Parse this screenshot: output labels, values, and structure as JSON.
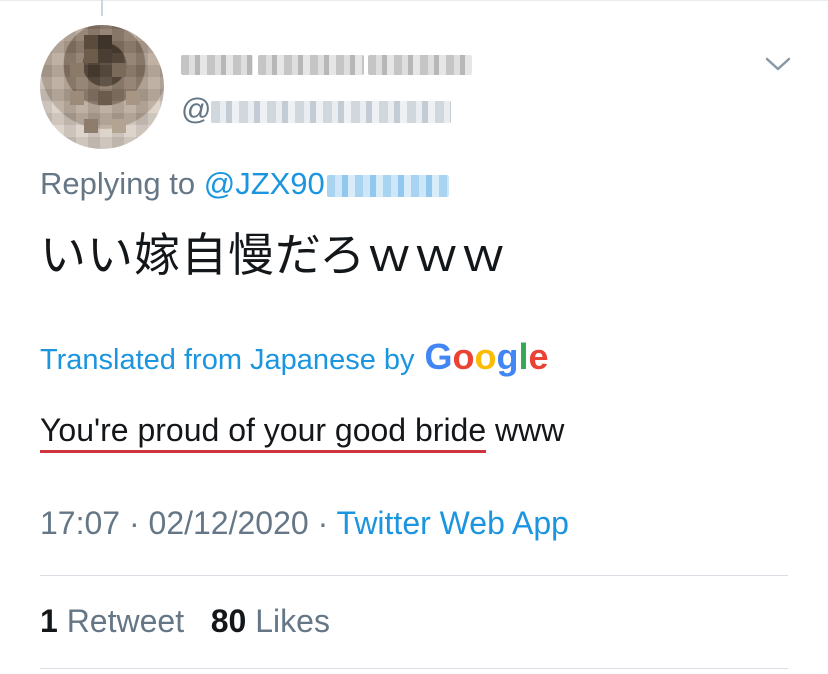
{
  "tweet": {
    "display_name_redacted": true,
    "handle_prefix": "@",
    "replying_label": "Replying to ",
    "reply_mention": "@JZX90",
    "text": "いい嫁自慢だろｗｗｗ",
    "translated_from": "Translated from Japanese by",
    "translation_provider": "Google",
    "translation_flagged": "You're proud of your good bride",
    "translation_rest": " www",
    "time": "17:07",
    "separator": " · ",
    "date": "02/12/2020",
    "source": "Twitter Web App",
    "retweet_count": "1",
    "retweet_label": "Retweet",
    "like_count": "80",
    "like_label": "Likes"
  },
  "icons": {
    "menu": "chevron-down-icon"
  },
  "colors": {
    "link": "#1b95e0",
    "secondary_text": "#657786",
    "primary_text": "#14171a",
    "flag_underline": "#d0343f",
    "google_blue": "#4285f4",
    "google_red": "#ea4335",
    "google_yellow": "#fbbc05",
    "google_green": "#34a853"
  }
}
